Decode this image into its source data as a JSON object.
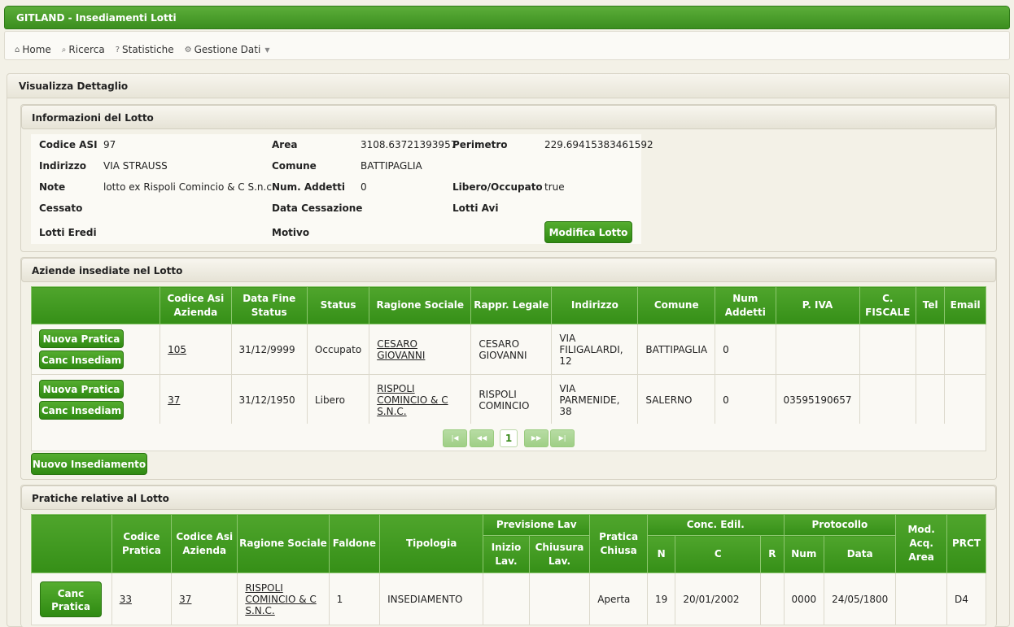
{
  "app": {
    "title": "GITLAND - Insediamenti Lotti"
  },
  "menu": [
    {
      "label": "Home",
      "icon": "home-icon",
      "glyph": "⌂"
    },
    {
      "label": "Ricerca",
      "icon": "search-icon",
      "glyph": "⌕"
    },
    {
      "label": "Statistiche",
      "icon": "question-icon",
      "glyph": "?"
    },
    {
      "label": "Gestione Dati",
      "icon": "gear-icon",
      "glyph": "⚙"
    }
  ],
  "detail": {
    "title": "Visualizza Dettaglio"
  },
  "info": {
    "title": "Informazioni del Lotto",
    "codice_asi_label": "Codice ASI",
    "codice_asi": "97",
    "area_label": "Area",
    "area": "3108.63721393957",
    "perimetro_label": "Perimetro",
    "perimetro": "229.69415383461592",
    "indirizzo_label": "Indirizzo",
    "indirizzo": "VIA STRAUSS",
    "comune_label": "Comune",
    "comune": "BATTIPAGLIA",
    "note_label": "Note",
    "note": "lotto ex Rispoli Comincio & C S.n.c.",
    "num_addetti_label": "Num. Addetti",
    "num_addetti": "0",
    "libero_label": "Libero/Occupato",
    "libero": "true",
    "cessato_label": "Cessato",
    "data_cessazione_label": "Data Cessazione",
    "lotti_avi_label": "Lotti Avi",
    "lotti_eredi_label": "Lotti Eredi",
    "motivo_label": "Motivo",
    "modifica_button": "Modifica Lotto"
  },
  "aziende": {
    "title": "Aziende insediate nel Lotto",
    "headers": [
      "",
      "Codice Asi Azienda",
      "Data Fine Status",
      "Status",
      "Ragione Sociale",
      "Rappr. Legale",
      "Indirizzo",
      "Comune",
      "Num Addetti",
      "P. IVA",
      "C. FISCALE",
      "Tel",
      "Email"
    ],
    "nuova_pratica": "Nuova Pratica",
    "canc_insediam": "Canc Insediam",
    "rows": [
      {
        "codice": "105",
        "data_fine": "31/12/9999",
        "status": "Occupato",
        "ragione": "CESARO GIOVANNI",
        "rappr": "CESARO GIOVANNI",
        "indirizzo": "VIA FILIGALARDI, 12",
        "comune": "BATTIPAGLIA",
        "addetti": "0",
        "piva": "",
        "cf": "",
        "tel": "",
        "email": ""
      },
      {
        "codice": "37",
        "data_fine": "31/12/1950",
        "status": "Libero",
        "ragione": "RISPOLI COMINCIO & C S.N.C.",
        "rappr": "RISPOLI COMINCIO",
        "indirizzo": "VIA PARMENIDE, 38",
        "comune": "SALERNO",
        "addetti": "0",
        "piva": "03595190657",
        "cf": "",
        "tel": "",
        "email": ""
      }
    ],
    "pager": {
      "current": "1"
    },
    "nuovo_insediamento": "Nuovo Insediamento"
  },
  "pratiche": {
    "title": "Pratiche relative al Lotto",
    "headers": {
      "codice_pratica": "Codice Pratica",
      "codice_asi": "Codice Asi Azienda",
      "ragione": "Ragione Sociale",
      "faldone": "Faldone",
      "tipologia": "Tipologia",
      "previsione": "Previsione Lav",
      "inizio": "Inizio Lav.",
      "chiusura": "Chiusura Lav.",
      "pratica_chiusa": "Pratica Chiusa",
      "conc_edil": "Conc. Edil.",
      "n": "N",
      "c": "C",
      "r": "R",
      "protocollo": "Protocollo",
      "num": "Num",
      "data": "Data",
      "mod_acq": "Mod. Acq. Area",
      "prct": "PRCT"
    },
    "canc_pratica": "Canc Pratica",
    "rows": [
      {
        "codice_pratica": "33",
        "codice_asi": "37",
        "ragione": "RISPOLI COMINCIO & C S.N.C.",
        "faldone": "1",
        "tipologia": "INSEDIAMENTO",
        "inizio": "",
        "chiusura": "",
        "pratica_chiusa": "Aperta",
        "n": "19",
        "c": "20/01/2002",
        "r": "",
        "num": "0000",
        "data": "24/05/1800",
        "mod_acq": "",
        "prct": "D4"
      }
    ]
  }
}
